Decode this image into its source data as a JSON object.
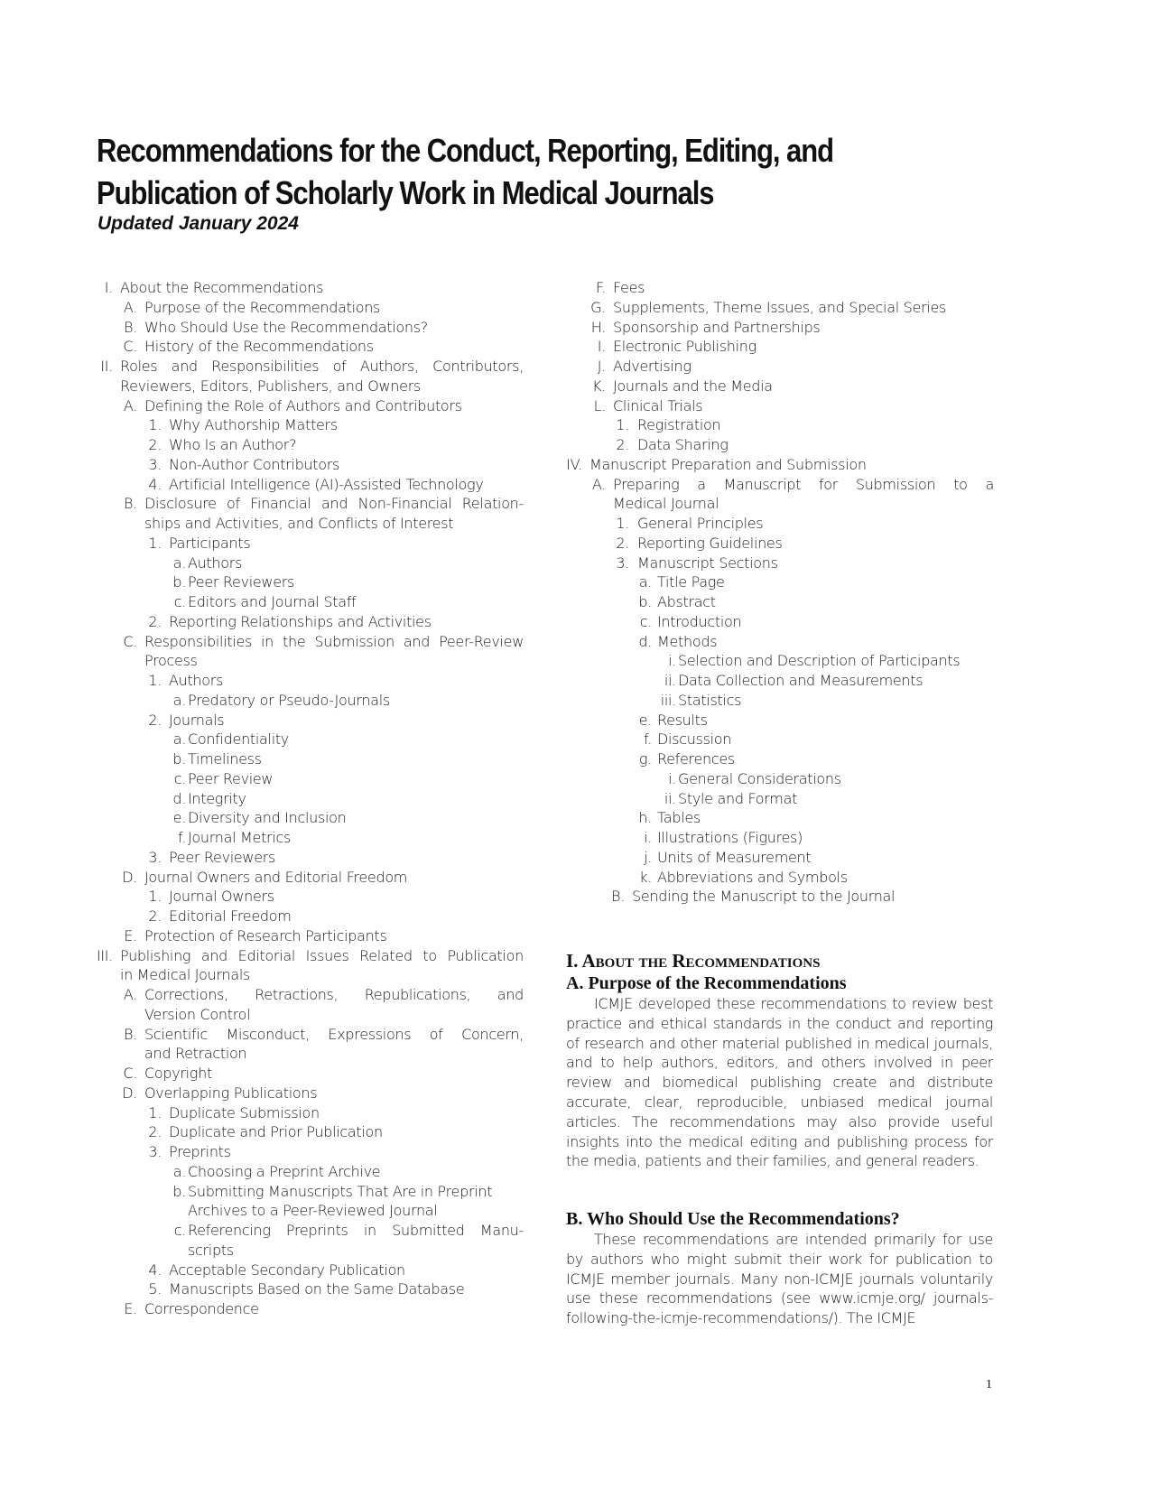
{
  "document": {
    "title_line1": "Recommendations for the Conduct, Reporting, Editing, and",
    "title_line2": "Publication of Scholarly Work in Medical Journals",
    "subtitle": "Updated January 2024",
    "page_number": "1"
  },
  "toc": {
    "left": [
      {
        "marker": "I.",
        "text": "About the Recommendations",
        "level": 0
      },
      {
        "marker": "A.",
        "text": "Purpose of the Recommendations",
        "level": 1
      },
      {
        "marker": "B.",
        "text": "Who Should Use the Recommendations?",
        "level": 1
      },
      {
        "marker": "C.",
        "text": "History of the Recommendations",
        "level": 1
      },
      {
        "marker": "II.",
        "text": "Roles and Responsibilities of Authors, Contributors,",
        "level": 0,
        "justify": true
      },
      {
        "marker": "",
        "text": "Reviewers, Editors, Publishers, and Owners",
        "level": 0
      },
      {
        "marker": "A.",
        "text": "Defining the Role of Authors and Contributors",
        "level": 1
      },
      {
        "marker": "1.",
        "text": "Why Authorship Matters",
        "level": 2
      },
      {
        "marker": "2.",
        "text": "Who Is an Author?",
        "level": 2
      },
      {
        "marker": "3.",
        "text": "Non-Author Contributors",
        "level": 2
      },
      {
        "marker": "4.",
        "text": "Artificial Intelligence (AI)-Assisted Technology",
        "level": 2
      },
      {
        "marker": "B.",
        "text": "Disclosure of Financial and Non-Financial Relation-",
        "level": 1,
        "justify": true
      },
      {
        "marker": "",
        "text": "ships and Activities, and Conflicts of Interest",
        "level": 1
      },
      {
        "marker": "1.",
        "text": "Participants",
        "level": 2
      },
      {
        "marker": "a.",
        "text": "Authors",
        "level": 3
      },
      {
        "marker": "b.",
        "text": "Peer Reviewers",
        "level": 3
      },
      {
        "marker": "c.",
        "text": "Editors and Journal Staff",
        "level": 3
      },
      {
        "marker": "2.",
        "text": "Reporting Relationships and Activities",
        "level": 2
      },
      {
        "marker": "C.",
        "text": "Responsibilities in the Submission and Peer-Review",
        "level": 1,
        "justify": true
      },
      {
        "marker": "",
        "text": "Process",
        "level": 1
      },
      {
        "marker": "1.",
        "text": "Authors",
        "level": 2
      },
      {
        "marker": "a.",
        "text": "Predatory or Pseudo-Journals",
        "level": 3
      },
      {
        "marker": "2.",
        "text": "Journals",
        "level": 2
      },
      {
        "marker": "a.",
        "text": "Confidentiality",
        "level": 3
      },
      {
        "marker": "b.",
        "text": "Timeliness",
        "level": 3
      },
      {
        "marker": "c.",
        "text": "Peer Review",
        "level": 3
      },
      {
        "marker": "d.",
        "text": "Integrity",
        "level": 3
      },
      {
        "marker": "e.",
        "text": "Diversity and Inclusion",
        "level": 3
      },
      {
        "marker": "f.",
        "text": "Journal Metrics",
        "level": 3
      },
      {
        "marker": "3.",
        "text": "Peer Reviewers",
        "level": 2
      },
      {
        "marker": "D.",
        "text": "Journal Owners and Editorial Freedom",
        "level": 1
      },
      {
        "marker": "1.",
        "text": "Journal Owners",
        "level": 2
      },
      {
        "marker": "2.",
        "text": "Editorial Freedom",
        "level": 2
      },
      {
        "marker": "E.",
        "text": "Protection of Research Participants",
        "level": 1
      },
      {
        "marker": "III.",
        "text": "Publishing and Editorial Issues Related to Publication",
        "level": 0,
        "justify": true
      },
      {
        "marker": "",
        "text": "in Medical Journals",
        "level": 0
      },
      {
        "marker": "A.",
        "text": "Corrections, Retractions, Republications, and",
        "level": 1,
        "justify": true
      },
      {
        "marker": "",
        "text": "Version Control",
        "level": 1
      },
      {
        "marker": "B.",
        "text": "Scientific Misconduct, Expressions of Concern,",
        "level": 1,
        "justify": true
      },
      {
        "marker": "",
        "text": "and Retraction",
        "level": 1
      },
      {
        "marker": "C.",
        "text": "Copyright",
        "level": 1
      },
      {
        "marker": "D.",
        "text": "Overlapping Publications",
        "level": 1
      },
      {
        "marker": "1.",
        "text": "Duplicate Submission",
        "level": 2
      },
      {
        "marker": "2.",
        "text": "Duplicate and Prior Publication",
        "level": 2
      },
      {
        "marker": "3.",
        "text": "Preprints",
        "level": 2
      },
      {
        "marker": "a.",
        "text": "Choosing a Preprint Archive",
        "level": 3
      },
      {
        "marker": "b.",
        "text": "Submitting Manuscripts That Are in Preprint",
        "level": 3
      },
      {
        "marker": "",
        "text": "Archives to a Peer-Reviewed Journal",
        "level": 3
      },
      {
        "marker": "c.",
        "text": "Referencing Preprints in Submitted Manu-",
        "level": 3,
        "justify": true
      },
      {
        "marker": "",
        "text": "scripts",
        "level": 3
      },
      {
        "marker": "4.",
        "text": "Acceptable Secondary Publication",
        "level": 2
      },
      {
        "marker": "5.",
        "text": "Manuscripts Based on the Same Database",
        "level": 2
      },
      {
        "marker": "E.",
        "text": "Correspondence",
        "level": 1
      }
    ],
    "right": [
      {
        "marker": "F.",
        "text": "Fees",
        "level": 1
      },
      {
        "marker": "G.",
        "text": "Supplements, Theme Issues, and Special Series",
        "level": 1
      },
      {
        "marker": "H.",
        "text": "Sponsorship and Partnerships",
        "level": 1
      },
      {
        "marker": "I.",
        "text": "Electronic Publishing",
        "level": 1
      },
      {
        "marker": "J.",
        "text": "Advertising",
        "level": 1
      },
      {
        "marker": "K.",
        "text": "Journals and the Media",
        "level": 1
      },
      {
        "marker": "L.",
        "text": "Clinical Trials",
        "level": 1
      },
      {
        "marker": "1.",
        "text": "Registration",
        "level": 2
      },
      {
        "marker": "2.",
        "text": "Data Sharing",
        "level": 2
      },
      {
        "marker": "IV.",
        "text": "Manuscript Preparation and Submission",
        "level": 0
      },
      {
        "marker": "A.",
        "text": "Preparing a Manuscript for Submission to a",
        "level": 1,
        "justify": true
      },
      {
        "marker": "",
        "text": "Medical Journal",
        "level": 1
      },
      {
        "marker": "1.",
        "text": "General Principles",
        "level": 2
      },
      {
        "marker": "2.",
        "text": "Reporting Guidelines",
        "level": 2
      },
      {
        "marker": "3.",
        "text": "Manuscript Sections",
        "level": 2
      },
      {
        "marker": "a.",
        "text": "Title Page",
        "level": 3
      },
      {
        "marker": "b.",
        "text": "Abstract",
        "level": 3
      },
      {
        "marker": "c.",
        "text": "Introduction",
        "level": 3
      },
      {
        "marker": "d.",
        "text": "Methods",
        "level": 3
      },
      {
        "marker": "i.",
        "text": "Selection and Description of Participants",
        "level": 4
      },
      {
        "marker": "ii.",
        "text": "Data Collection and Measurements",
        "level": 4
      },
      {
        "marker": "iii.",
        "text": "Statistics",
        "level": 4
      },
      {
        "marker": "e.",
        "text": "Results",
        "level": 3
      },
      {
        "marker": "f.",
        "text": "Discussion",
        "level": 3
      },
      {
        "marker": "g.",
        "text": "References",
        "level": 3
      },
      {
        "marker": "i.",
        "text": "General Considerations",
        "level": 4
      },
      {
        "marker": "ii.",
        "text": "Style and Format",
        "level": 4
      },
      {
        "marker": "h.",
        "text": "Tables",
        "level": 3
      },
      {
        "marker": "i.",
        "text": "Illustrations (Figures)",
        "level": 3
      },
      {
        "marker": "j.",
        "text": "Units of Measurement",
        "level": 3
      },
      {
        "marker": "k.",
        "text": "Abbreviations and Symbols",
        "level": 3
      },
      {
        "marker": "B.",
        "text": "Sending the Manuscript to the Journal",
        "level": 0.5
      }
    ]
  },
  "body": {
    "section_heading": "I. About the Recommendations",
    "subsection_a_heading": "A. Purpose of the Recommendations",
    "subsection_a_text": "ICMJE developed these recommendations to review best practice and ethical standards in the conduct and reporting of research and other material published in medical journals, and to help authors, editors, and others involved in peer review and biomedical publishing cre­ate and distribute accurate, clear, reproducible, unbia­sed medical journal articles. The recommendations may also provide useful insights into the medical editing and publishing process for the media, patients and their fami­lies, and general readers.",
    "subsection_b_heading": "B. Who Should Use the Recommendations?",
    "subsection_b_text": "These recommendations are intended primarily for use by authors who might submit their work for publication to ICMJE member journals. Many non-ICMJE journals vol­untarily use these recommendations (see www.icmje.org/ journals-following-the-icmje-recommendations/). The ICMJE"
  }
}
